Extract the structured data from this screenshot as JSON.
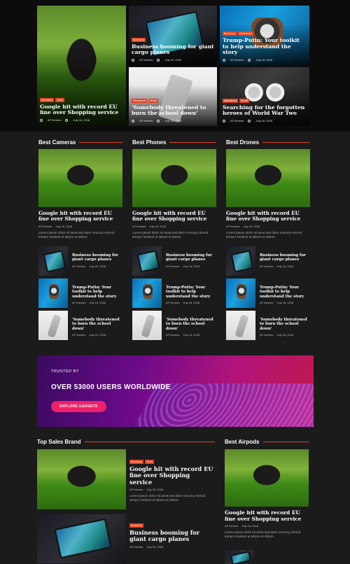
{
  "hero": {
    "main": {
      "tags": [
        "Business",
        "Tech"
      ],
      "title": "Google hit with record EU fine over Shopping service",
      "author": "AF themes",
      "date": "July 18, 2018"
    },
    "tablet": {
      "tags": [
        "Business"
      ],
      "title": "Business booming for giant cargo planes",
      "author": "AF themes",
      "date": "July 18, 2018"
    },
    "watch": {
      "tags": [
        "Business",
        "Newsbeat"
      ],
      "title": "Trump-Putin: Your toolkit to help understand the story",
      "author": "AF themes",
      "date": "July 18, 2018"
    },
    "phone": {
      "tags": [
        "Newsbeat",
        "World"
      ],
      "title": "'Somebody threatened to burn the school down'",
      "author": "AF themes",
      "date": "July 18, 2018"
    },
    "headphones": {
      "tags": [
        "Newsbeat",
        "World"
      ],
      "title": "Searching for the forgotten heroes of World War Two",
      "author": "AF themes",
      "date": "July 18, 2018"
    }
  },
  "columns": [
    {
      "heading": "Best Cameras",
      "lead": {
        "title": "Google hit with record EU fine over Shopping service",
        "author": "AF themes",
        "date": "July 18, 2018",
        "excerpt": "Lorem ipsum dolor sit amet,sed diam nonumy eirmod tempor invidunt ut labore et dolore"
      },
      "items": [
        {
          "title": "Business booming for giant cargo planes",
          "author": "AF themes",
          "date": "July 18, 2018"
        },
        {
          "title": "Trump-Putin: Your toolkit to help understand the story",
          "author": "AF themes",
          "date": "July 18, 2018"
        },
        {
          "title": "'Somebody threatened to burn the school down'",
          "author": "AF themes",
          "date": "July 18, 2018"
        }
      ]
    },
    {
      "heading": "Best Phones",
      "lead": {
        "title": "Google hit with record EU fine over Shopping service",
        "author": "AF themes",
        "date": "July 18, 2018",
        "excerpt": "Lorem ipsum dolor sit amet,sed diam nonumy eirmod tempor invidunt ut labore et dolore"
      },
      "items": [
        {
          "title": "Business booming for giant cargo planes",
          "author": "AF themes",
          "date": "July 18, 2018"
        },
        {
          "title": "Trump-Putin: Your toolkit to help understand the story",
          "author": "AF themes",
          "date": "July 18, 2018"
        },
        {
          "title": "'Somebody threatened to burn the school down'",
          "author": "AF themes",
          "date": "July 18, 2018"
        }
      ]
    },
    {
      "heading": "Best Drones",
      "lead": {
        "title": "Google hit with record EU fine over Shopping service",
        "author": "AF themes",
        "date": "July 18, 2018",
        "excerpt": "Lorem ipsum dolor sit amet,sed diam nonumy eirmod tempor invidunt ut labore et dolore"
      },
      "items": [
        {
          "title": "Business booming for giant cargo planes",
          "author": "AF themes",
          "date": "July 18, 2018"
        },
        {
          "title": "Trump-Putin: Your toolkit to help understand the story",
          "author": "AF themes",
          "date": "July 18, 2018"
        },
        {
          "title": "'Somebody threatened to burn the school down'",
          "author": "AF themes",
          "date": "July 18, 2018"
        }
      ]
    }
  ],
  "banner": {
    "kicker": "TRUSTED BY",
    "headline": "OVER 53000 USERS WORLDWIDE",
    "button": "EXPLORE GADGETS"
  },
  "top_sales": {
    "heading": "Top Sales Brand",
    "items": [
      {
        "tags": [
          "Business",
          "Tech"
        ],
        "title": "Google hit with record EU fine over Shopping service",
        "author": "AF themes",
        "date": "July 18, 2018",
        "excerpt": "Lorem ipsum dolor sit amet,sed diam nonumy eirmod tempor invidunt ut labore et dolore"
      },
      {
        "tags": [
          "Business"
        ],
        "title": "Business booming for giant cargo planes",
        "author": "AF themes",
        "date": "July 18, 2018"
      }
    ]
  },
  "airpods": {
    "heading": "Best Airpods",
    "lead": {
      "title": "Google hit with record EU fine over Shopping service",
      "author": "AF themes",
      "date": "July 18, 2018",
      "excerpt": "Lorem ipsum dolor sit amet,sed diam nonumy eirmod tempor invidunt ut labore et dolore"
    }
  },
  "colors": {
    "accent": "#e8431f",
    "page_bg": "#1b1b1b",
    "top_bg": "#0c0c0c",
    "button": "#f01f6a"
  },
  "icons": {
    "author": "user-icon",
    "date": "clock-icon"
  }
}
